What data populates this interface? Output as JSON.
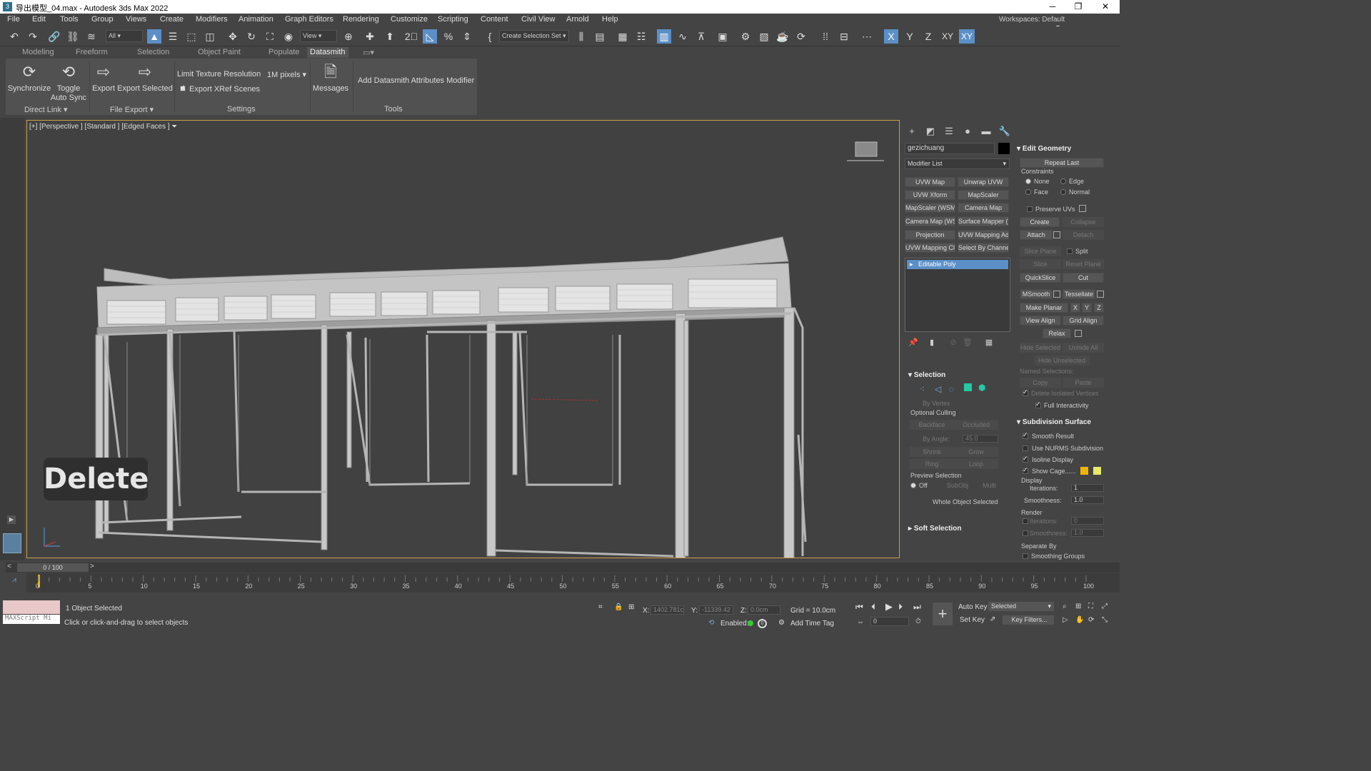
{
  "window": {
    "title": "导出模型_04.max - Autodesk 3ds Max 2022"
  },
  "menus": [
    "File",
    "Edit",
    "Tools",
    "Group",
    "Views",
    "Create",
    "Modifiers",
    "Animation",
    "Graph Editors",
    "Rendering",
    "Customize",
    "Scripting",
    "Content",
    "Civil View",
    "Arnold",
    "Help"
  ],
  "workspaces": {
    "label": "Workspaces:",
    "value": "Default"
  },
  "toolbar": {
    "filter_value": "All",
    "view_value": "View",
    "selection_set": "Create Selection Set",
    "axes": [
      "X",
      "Y",
      "Z",
      "XY",
      "XY"
    ]
  },
  "ribbon_tabs": [
    "Modeling",
    "Freeform",
    "Selection",
    "Object Paint",
    "Populate",
    "Datasmith"
  ],
  "ribbon": {
    "synchronize": "Synchronize",
    "toggle": "Toggle",
    "auto_sync": "Auto Sync",
    "export": "Export",
    "export_selected": "Export Selected",
    "limit_texture": "Limit Texture Resolution",
    "pixels": "1M pixels",
    "export_xref": "Export XRef Scenes",
    "messages": "Messages",
    "add_attributes": "Add Datasmith Attributes Modifier",
    "sections": [
      "Direct Link",
      "File Export",
      "Settings",
      "Tools"
    ]
  },
  "viewport": {
    "label": "[+] [Perspective ] [Standard ] [Edged Faces ]",
    "overlay": "Delete"
  },
  "command_panel": {
    "object_name": "gezichuang",
    "modifier_list": "Modifier List",
    "modifiers": [
      "UVW Map",
      "Unwrap UVW",
      "UVW Xform",
      "MapScaler",
      "MapScaler (WSM)",
      "Camera Map",
      "Camera Map (WSM)",
      "Surface Mapper (WSM)",
      "Projection",
      "UVW Mapping Add",
      "UVW Mapping Clear",
      "Select By Channel"
    ],
    "stack_item": "Editable Poly",
    "selection": {
      "header": "Selection",
      "by_vertex": "By Vertex",
      "optional_culling": "Optional Culling",
      "backface": "Backface",
      "occluded": "Occluded",
      "by_angle": "By Angle:",
      "angle_value": "45.0",
      "shrink": "Shrink",
      "grow": "Grow",
      "ring": "Ring",
      "loop": "Loop",
      "preview": "Preview Selection",
      "off": "Off",
      "subobj": "SubObj",
      "multi": "Multi",
      "status": "Whole Object Selected"
    },
    "soft_selection": "Soft Selection",
    "edit_geometry": {
      "header": "Edit Geometry",
      "repeat_last": "Repeat Last",
      "constraints": "Constraints",
      "none": "None",
      "edge": "Edge",
      "face": "Face",
      "normal": "Normal",
      "preserve_uvs": "Preserve UVs",
      "create": "Create",
      "collapse": "Collapse",
      "attach": "Attach",
      "detach": "Detach",
      "slice_plane": "Slice Plane",
      "split": "Split",
      "slice": "Slice",
      "reset_plane": "Reset Plane",
      "quickslice": "QuickSlice",
      "cut": "Cut",
      "msmooth": "MSmooth",
      "tessellate": "Tessellate",
      "make_planar": "Make Planar",
      "x": "X",
      "y": "Y",
      "z": "Z",
      "view_align": "View Align",
      "grid_align": "Grid Align",
      "relax": "Relax",
      "hide_selected": "Hide Selected",
      "unhide_all": "Unhide All",
      "hide_unselected": "Hide Unselected",
      "named_selections": "Named Selections:",
      "copy": "Copy",
      "paste": "Paste",
      "delete_isolated": "Delete Isolated Vertices",
      "full_interactivity": "Full Interactivity"
    },
    "subdivision": {
      "header": "Subdivision Surface",
      "smooth_result": "Smooth Result",
      "use_nurms": "Use NURMS Subdivision",
      "isoline": "Isoline Display",
      "show_cage": "Show Cage......",
      "display": "Display",
      "iterations": "Iterations:",
      "iter_value": "1",
      "smoothness": "Smoothness:",
      "smooth_value": "1.0",
      "render": "Render",
      "r_iter_value": "0",
      "r_smooth_value": "1.0",
      "separate_by": "Separate By",
      "smoothing_groups": "Smoothing Groups"
    }
  },
  "timeline": {
    "frame": "0 / 100",
    "ticks": [
      "0",
      "5",
      "10",
      "15",
      "20",
      "25",
      "30",
      "35",
      "40",
      "45",
      "50",
      "55",
      "60",
      "65",
      "70",
      "75",
      "80",
      "85",
      "90",
      "95",
      "100"
    ]
  },
  "status": {
    "selected": "1 Object Selected",
    "prompt": "Click or click-and-drag to select objects",
    "maxscript": "MAXScript Mi",
    "x_label": "X:",
    "x_value": "1402.781c",
    "y_label": "Y:",
    "y_value": "-11339.42",
    "z_label": "Z:",
    "z_value": "0.0cm",
    "grid": "Grid = 10.0cm",
    "enabled": "Enabled:",
    "add_time_tag": "Add Time Tag",
    "auto_key": "Auto Key",
    "set_key": "Set Key",
    "key_mode": "Selected",
    "key_filters": "Key Filters...",
    "frame_value": "0"
  },
  "colors": {
    "accent": "#5b8fc7",
    "viewport_border": "#c8a14a",
    "cage1": "#f2b400",
    "cage2": "#e8e86a"
  }
}
